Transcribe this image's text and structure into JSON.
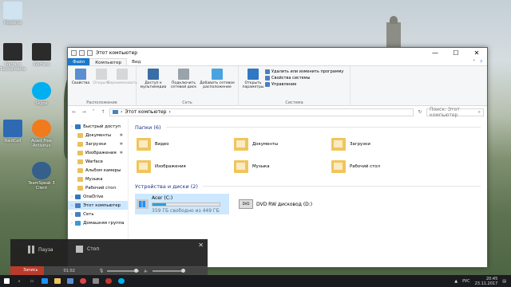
{
  "desktop": {
    "icons": [
      {
        "label": "Корзина",
        "color": "#cfe3f0"
      },
      {
        "label": "Warface Tournaments",
        "color": "#2b2b2b"
      },
      {
        "label": "Warface",
        "color": "#2b2b2b"
      },
      {
        "label": "Skype",
        "color": "#00aff0"
      },
      {
        "label": "RaidCall",
        "color": "#2d6ab3"
      },
      {
        "label": "Avast Free Antivirus",
        "color": "#f07a1c"
      },
      {
        "label": "TeamSpeak 3 Client",
        "color": "#35608c"
      }
    ]
  },
  "window": {
    "title": "Этот компьютер",
    "controls": {
      "minimize": "—",
      "maximize": "☐",
      "close": "✕"
    },
    "ribbon_tabs": [
      "Файл",
      "Компьютер",
      "Вид"
    ],
    "ribbon": {
      "location": {
        "label": "Расположение",
        "buttons": [
          "Свойства",
          "Открыть",
          "Переименовать"
        ]
      },
      "network": {
        "label": "Сеть",
        "buttons": [
          "Доступ к мультимедиа",
          "Подключить сетевой диск",
          "Добавить сетевое расположение"
        ]
      },
      "system": {
        "label": "Система",
        "open_params": "Открыть параметры",
        "links": [
          "Удалить или изменить программу",
          "Свойства системы",
          "Управление"
        ]
      }
    },
    "address": {
      "path": "Этот компьютер",
      "search_placeholder": "Поиск: Этот компьютер"
    },
    "sidebar": [
      {
        "label": "Быстрый доступ",
        "icon": "star-icon",
        "level": 0,
        "pinned": false
      },
      {
        "label": "Документы",
        "icon": "folder-icon",
        "level": 1,
        "pinned": true
      },
      {
        "label": "Загрузки",
        "icon": "folder-icon",
        "level": 1,
        "pinned": true
      },
      {
        "label": "Изображения",
        "icon": "folder-icon",
        "level": 1,
        "pinned": true
      },
      {
        "label": "Warface",
        "icon": "folder-icon",
        "level": 1,
        "pinned": false
      },
      {
        "label": "Альбом камеры",
        "icon": "folder-icon",
        "level": 1,
        "pinned": false
      },
      {
        "label": "Музыка",
        "icon": "folder-icon",
        "level": 1,
        "pinned": false
      },
      {
        "label": "Рабочий стол",
        "icon": "folder-icon",
        "level": 1,
        "pinned": false
      },
      {
        "label": "OneDrive",
        "icon": "cloud-icon",
        "level": 0,
        "pinned": false
      },
      {
        "label": "Этот компьютер",
        "icon": "pc-icon",
        "level": 0,
        "pinned": false,
        "active": true
      },
      {
        "label": "Сеть",
        "icon": "network-icon",
        "level": 0,
        "pinned": false
      },
      {
        "label": "Домашняя группа",
        "icon": "homegroup-icon",
        "level": 0,
        "pinned": false
      }
    ],
    "folders_header": "Папки (6)",
    "folders": [
      "Видео",
      "Документы",
      "Загрузки",
      "Изображения",
      "Музыка",
      "Рабочий стол"
    ],
    "drives_header": "Устройства и диски (2)",
    "drives": [
      {
        "name": "Acer (C:)",
        "free": "359 ГБ свободно из 449 ГБ",
        "used_fraction": 0.2
      },
      {
        "name": "DVD RW дисковод (D:)"
      }
    ]
  },
  "recorder": {
    "pause": "Пауза",
    "stop": "Стоп",
    "recording": "Запись",
    "time": "01:02"
  },
  "taskbar": {
    "lang": "РУС",
    "time": "20:45",
    "date": "23.11.2017"
  }
}
